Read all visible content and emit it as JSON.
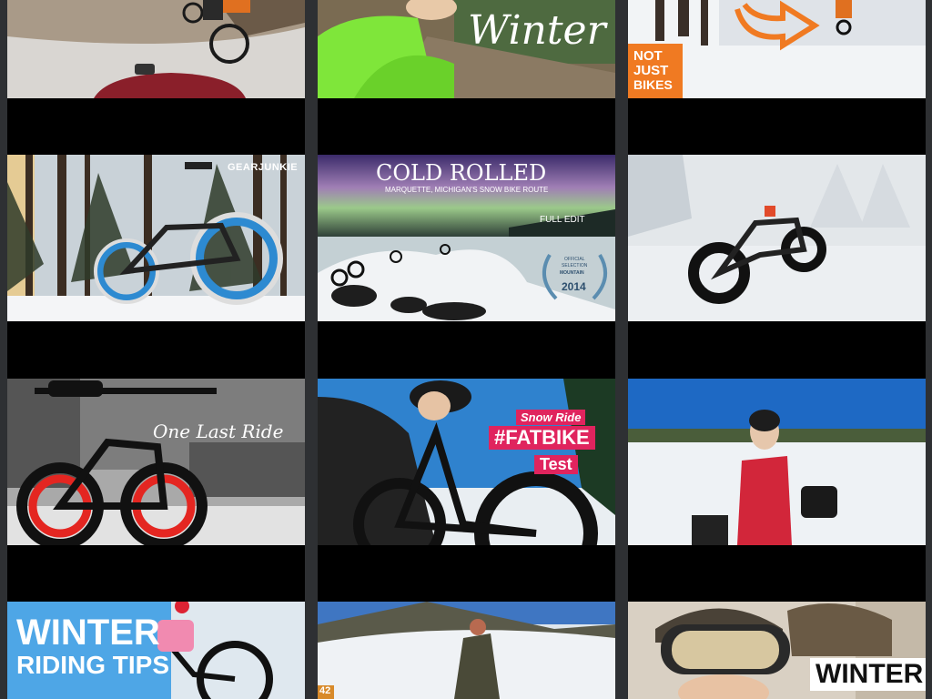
{
  "thumbnails": [
    {
      "id": "t1",
      "overlay": []
    },
    {
      "id": "t2",
      "overlay": [
        "Winter"
      ]
    },
    {
      "id": "t3",
      "overlay": [
        "NOT",
        "JUST",
        "BIKES"
      ]
    },
    {
      "id": "t4",
      "overlay": [
        "GEARJUNKIE"
      ]
    },
    {
      "id": "t5",
      "overlay": [
        "COLD ROLLED",
        "MARQUETTE, MICHIGAN'S SNOW BIKE ROUTE",
        "FULL EDIT",
        "OFFICIAL",
        "SELECTION",
        "MOUNTAIN",
        "2014"
      ]
    },
    {
      "id": "t6",
      "overlay": []
    },
    {
      "id": "t7",
      "overlay": [
        "One Last Ride"
      ]
    },
    {
      "id": "t8",
      "overlay": [
        "Snow Ride",
        "#FATBIKE",
        "Test"
      ]
    },
    {
      "id": "t9",
      "overlay": []
    },
    {
      "id": "t10",
      "overlay": [
        "WINTER",
        "RIDING TIPS"
      ]
    },
    {
      "id": "t11",
      "overlay": [
        "42"
      ]
    },
    {
      "id": "t12",
      "overlay": [
        "WINTER"
      ]
    }
  ],
  "colors": {
    "page_background": "#2e3033",
    "column_background": "#000000",
    "accent_orange": "#f07a22",
    "hashtag_pink": "#e0245e"
  },
  "icons": [
    "arrow-icon",
    "laurel-icon"
  ]
}
